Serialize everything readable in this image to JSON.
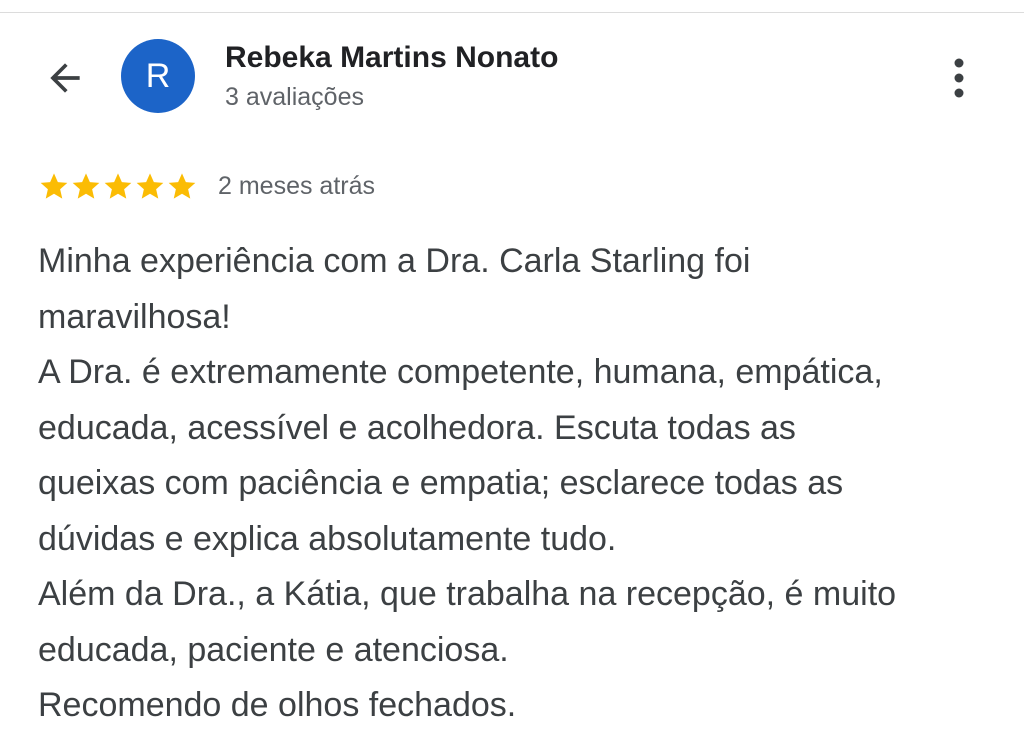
{
  "header": {
    "back_icon": "arrow-back-icon",
    "avatar_initial": "R",
    "avatar_color": "#1c64c8",
    "reviewer_name": "Rebeka Martins Nonato",
    "reviewer_reviews": "3 avaliações",
    "more_icon": "more-vertical-icon"
  },
  "review": {
    "rating": 5,
    "max_rating": 5,
    "star_color": "#fbbc04",
    "date": "2 meses atrás",
    "lines": [
      "Minha experiência com a Dra. Carla Starling foi",
      "maravilhosa!",
      "A Dra. é extremamente competente, humana, empática,",
      "educada, acessível e acolhedora. Escuta todas as",
      "queixas com paciência e empatia; esclarece todas as",
      "dúvidas e explica absolutamente tudo.",
      "Além da Dra., a Kátia, que trabalha na recepção, é muito",
      "educada, paciente e atenciosa.",
      "Recomendo de olhos fechados."
    ]
  }
}
